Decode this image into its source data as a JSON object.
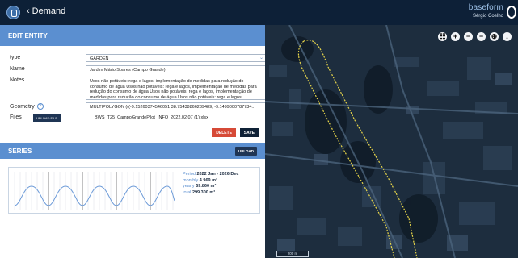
{
  "header": {
    "back_label": "Demand",
    "brand": "baseform",
    "user": "Sérgio Coelho"
  },
  "edit_entity": {
    "title": "EDIT ENTITY",
    "fields": {
      "type": {
        "label": "type",
        "value": "GARDEN"
      },
      "name": {
        "label": "Name",
        "value": "Jardim Mário Soares (Campo Grande)"
      },
      "notes": {
        "label": "Notes",
        "value": "Usos não potáveis: rega e lagos, implementação de medidas para redução do consumo de água Usos não potáveis: rega e lagos, implementação de medidas para redução do consumo de água Usos não potáveis: rega e lagos, implementação de medidas para redução do consumo de água Usos não potáveis: rega e lagos."
      },
      "geometry": {
        "label": "Geometry",
        "value": "MULTIPOLYGON (((-9.15260374546051 38.75438866239489, -9.1499000787734..."
      },
      "files": {
        "label": "Files",
        "upload_label": "UPLOAD FILE",
        "file_name": "BWS_T25_CampoGrandePilot_INFO_2022.02.07 (1).xlsx"
      }
    },
    "delete_label": "DELETE",
    "save_label": "SAVE"
  },
  "series": {
    "title": "SERIES",
    "upload_label": "UPLOAD",
    "period_label": "Period",
    "period_value": "2022 Jan - 2026 Dec",
    "monthly_label": "monthly",
    "monthly_value": "4.969 m³",
    "yearly_label": "yearly",
    "yearly_value": "59.860 m³",
    "total_label": "total",
    "total_value": "299.300 m³"
  },
  "map": {
    "scale_label": "200 m",
    "controls": [
      "layers-icon",
      "zoom-in-icon",
      "zoom-out-icon",
      "minus-icon",
      "locate-icon",
      "download-icon"
    ]
  },
  "colors": {
    "topbar": "#0d2037",
    "section_header": "#5b8fd0",
    "delete": "#d64a37",
    "save": "#0f2136",
    "polygon_outline": "#e8d64a"
  }
}
